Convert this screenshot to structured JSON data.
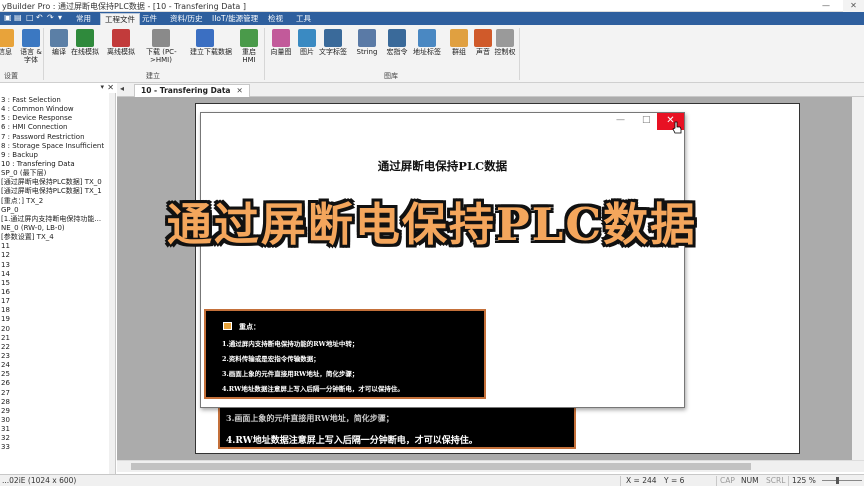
{
  "window": {
    "title": "yBuilder Pro : 通过屏断电保持PLC数据 - [10 - Transfering Data ]",
    "controls": {
      "minimize": "—",
      "close": "✕"
    }
  },
  "menu": {
    "items": [
      "常用",
      "工程文件",
      "元件",
      "资料/历史",
      "IIoT/能源管理",
      "检视",
      "工具"
    ],
    "active_index": 1
  },
  "ribbon": {
    "buttons": [
      {
        "label": "信息",
        "icon": "info-icon",
        "color": "#e8a33a"
      },
      {
        "label": "语言 &\n字体",
        "icon": "language-font-icon",
        "color": "#3b78c2"
      },
      {
        "label": "编译",
        "icon": "compile-icon",
        "color": "#5b7fa6"
      },
      {
        "label": "在线模拟",
        "icon": "online-simulation-icon",
        "color": "#2f8a3c"
      },
      {
        "label": "离线模拟",
        "icon": "offline-simulation-icon",
        "color": "#c23b3b"
      },
      {
        "label": "下载 (PC-\n>HMI)",
        "icon": "download-icon",
        "color": "#8a8a8a"
      },
      {
        "label": "建立下载数据",
        "icon": "build-download-icon",
        "color": "#3b6fc2"
      },
      {
        "label": "重启\nHMI",
        "icon": "restart-hmi-icon",
        "color": "#4a9a4a"
      },
      {
        "label": "向量图",
        "icon": "vector-graphic-icon",
        "color": "#c25a9a"
      },
      {
        "label": "图片",
        "icon": "picture-icon",
        "color": "#3a8ac2"
      },
      {
        "label": "文字标签",
        "icon": "text-label-icon",
        "color": "#3a6a9a"
      },
      {
        "label": "String",
        "icon": "string-table-icon",
        "color": "#5a7aa6"
      },
      {
        "label": "宏指令",
        "icon": "macro-icon",
        "color": "#3a6a9a"
      },
      {
        "label": "地址标签",
        "icon": "address-tag-icon",
        "color": "#4a88c2"
      },
      {
        "label": "群组",
        "icon": "group-icon",
        "color": "#e0a040"
      },
      {
        "label": "声音",
        "icon": "sound-icon",
        "color": "#d05a2a"
      },
      {
        "label": "控制权",
        "icon": "control-lock-icon",
        "color": "#9a9a9a"
      }
    ],
    "groups": [
      "设置",
      "建立",
      "图库"
    ]
  },
  "tree": {
    "items": [
      "3 : Fast Selection",
      "4 : Common Window",
      "5 : Device Response",
      "6 : HMI Connection",
      "7 : Password Restriction",
      "8 : Storage Space Insufficient",
      "9 : Backup",
      "10 : Transfering Data",
      "SP_0 (最下层)",
      "[通过屏断电保持PLC数据] TX_0",
      "[通过屏断电保持PLC数据] TX_1",
      "[重点：] TX_2",
      "GP_0",
      "[1.通过屏内支持断电保持功能...",
      "NE_0 (RW-0, LB-0)",
      "[参数设置] TX_4",
      "11",
      "12",
      "13",
      "14",
      "15",
      "16",
      "17",
      "18",
      "19",
      "20",
      "21",
      "22",
      "23",
      "24",
      "25",
      "26",
      "27",
      "28",
      "29",
      "30",
      "31",
      "32",
      "33"
    ],
    "selected_index": 7,
    "close_label": "✕",
    "pin_label": "▾"
  },
  "doc_tab": {
    "label": "10 - Transfering Data",
    "close": "✕"
  },
  "screen": {
    "popup_title": "通过屏断电保持PLC数据",
    "popup_close": "✕",
    "popup_panel": {
      "heading": "重点：",
      "lines": [
        "1.通过屏内支持断电保持功能的RW地址中转；",
        "2.资料传输或是宏指令传输数据；",
        "3.画面上象的元件直接用RW地址，简化步骤；",
        "4.RW地址数据注意屏上写入后隔一分钟断电，才可以保持住。"
      ]
    },
    "back_panel": {
      "partial_line": "3.画面上象的元件直接用RW地址，简化步骤；",
      "line": "4.RW地址数据注意屏上写入后隔一分钟断电，才可以保持住。"
    }
  },
  "caption": "通过屏断电保持PLC数据",
  "status": {
    "model": "...02iE (1024 x 600)",
    "x": "X = 244",
    "y": "Y = 6",
    "cap": "CAP",
    "num": "NUM",
    "scrl": "SCRL",
    "zoom": "125 %"
  }
}
